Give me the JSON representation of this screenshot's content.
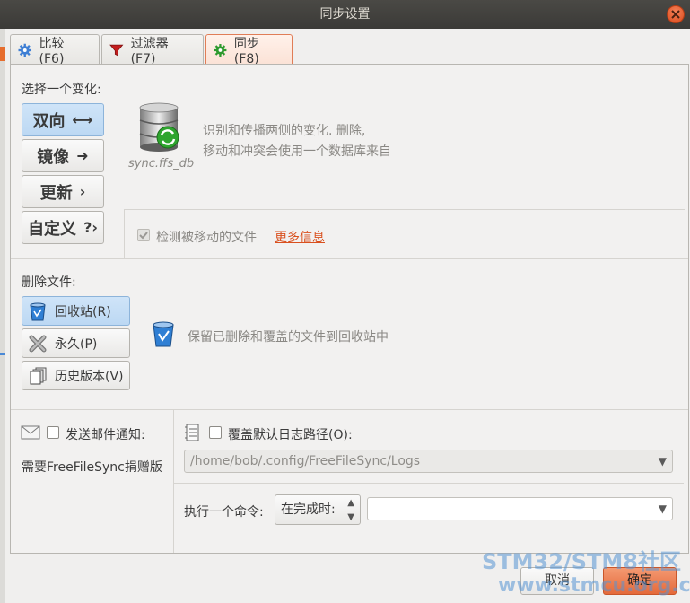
{
  "window": {
    "title": "同步设置"
  },
  "tabs": [
    {
      "label": "比较 (F6)",
      "icon": "gear-icon"
    },
    {
      "label": "过滤器 (F7)",
      "icon": "filter-icon"
    },
    {
      "label": "同步 (F8)",
      "icon": "gear-icon",
      "active": true
    }
  ],
  "variant": {
    "heading": "选择一个变化:",
    "buttons": [
      {
        "label": "双向",
        "glyph": "⟷",
        "selected": true
      },
      {
        "label": "镜像",
        "glyph": "➜"
      },
      {
        "label": "更新",
        "glyph": "›"
      },
      {
        "label": "自定义",
        "glyph": "?›"
      }
    ],
    "db_caption": "sync.ffs_db",
    "description_line1": "识别和传播两侧的变化. 删除,",
    "description_line2": "移动和冲突会使用一个数据库来自",
    "detect_moved_label": "检测被移动的文件",
    "more_info_link": "更多信息"
  },
  "deletion": {
    "heading": "删除文件:",
    "buttons": [
      {
        "label": "回收站(R)",
        "selected": true
      },
      {
        "label": "永久(P)"
      },
      {
        "label": "历史版本(V)"
      }
    ],
    "description": "保留已删除和覆盖的文件到回收站中"
  },
  "email": {
    "label": "发送邮件通知:",
    "note": "需要FreeFileSync捐赠版"
  },
  "log": {
    "label": "覆盖默认日志路径(O):",
    "path": "/home/bob/.config/FreeFileSync/Logs"
  },
  "command": {
    "label": "执行一个命令:",
    "when": "在完成时:",
    "value": ""
  },
  "footer": {
    "cancel_label": "取消",
    "ok_label": "确定"
  },
  "watermark": {
    "line1": "STM32/STM8社区",
    "line2": "www.stmcu.org.cn"
  },
  "colors": {
    "accent": "#e07d57",
    "selected_blue": "#bcd8f3",
    "link": "#d9501e"
  }
}
